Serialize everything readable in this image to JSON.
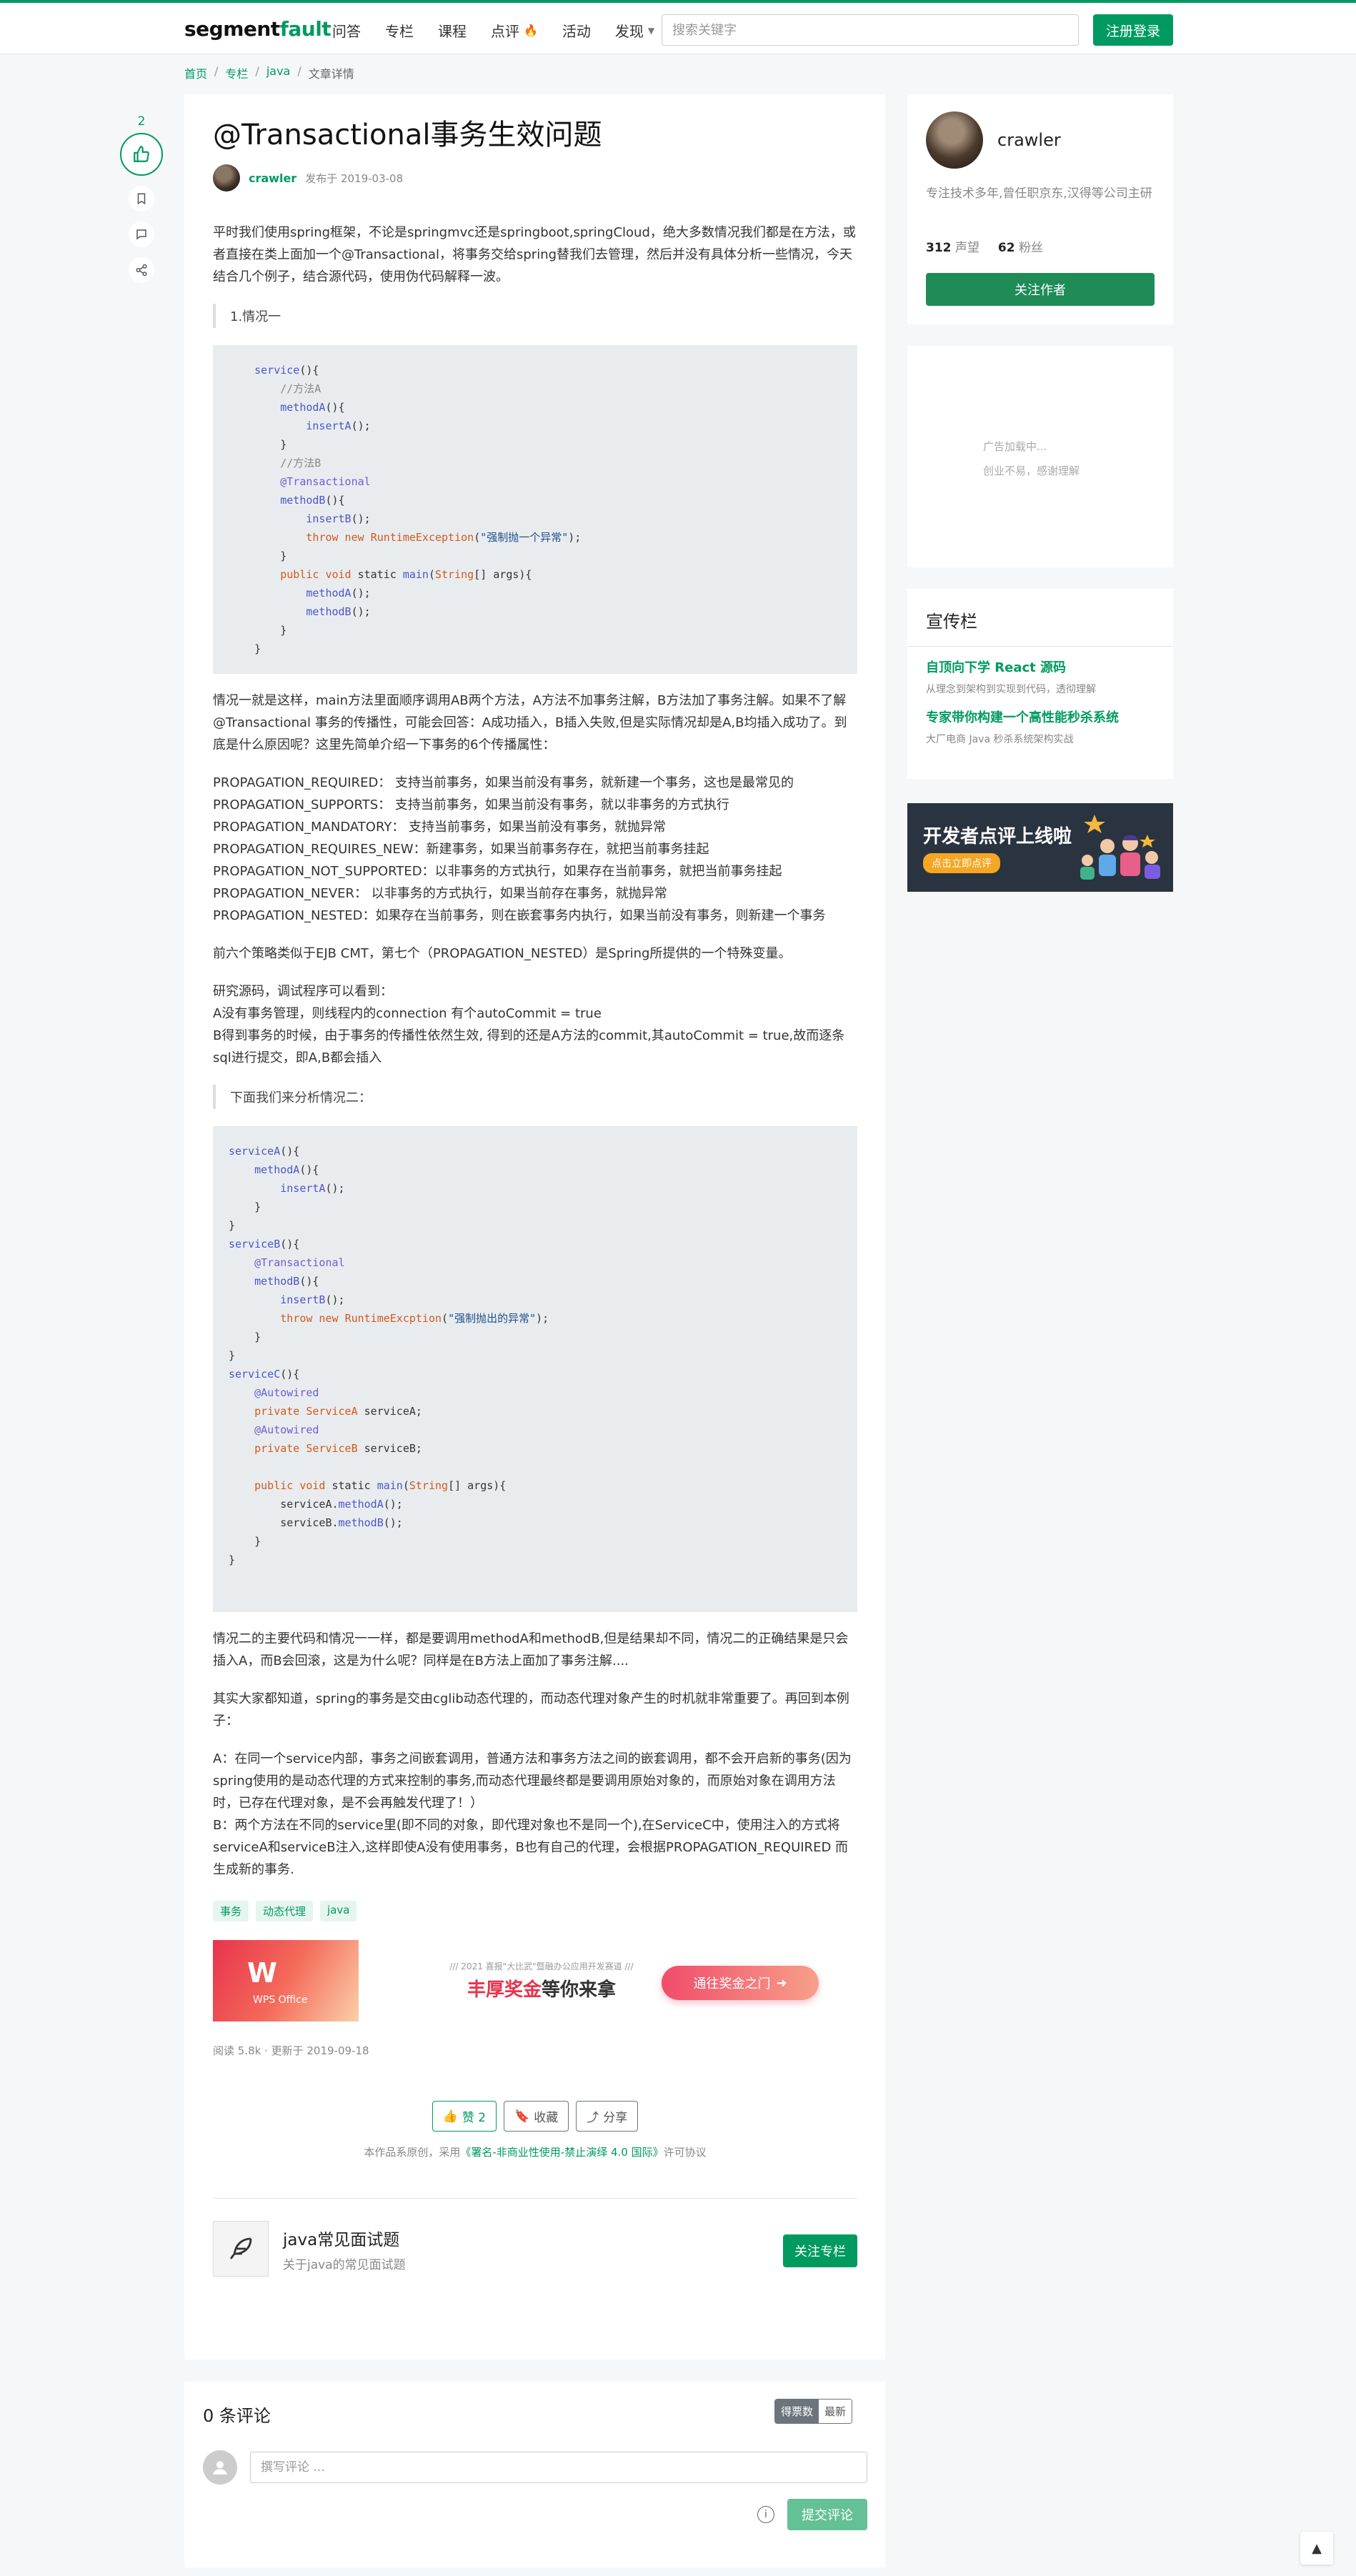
{
  "header": {
    "logo_text": "segment",
    "logo_bold": "fault",
    "nav": [
      "问答",
      "专栏",
      "课程",
      "点评",
      "活动",
      "发现"
    ],
    "search_placeholder": "搜索关键字",
    "register_label": "注册登录"
  },
  "breadcrumb": [
    "首页",
    "专栏",
    "java",
    "文章详情"
  ],
  "side": {
    "vote_count": "2"
  },
  "article": {
    "title": "@Transactional事务生效问题",
    "author": "crawler",
    "published": "发布于 2019-03-08",
    "intro": "平时我们使用spring框架，不论是springmvc还是springboot,springCloud，绝大多数情况我们都是在方法，或者直接在类上面加一个@Transactional，将事务交给spring替我们去管理，然后并没有具体分析一些情况，今天结合几个例子，结合源代码，使用伪代码解释一波。",
    "quote1": "1.情况一",
    "code1": [
      "    service(){",
      "        //方法A",
      "        methodA(){",
      "            insertA();",
      "        }",
      "        //方法B",
      "        @Transactional",
      "        methodB(){",
      "            insertB();",
      "            throw new RuntimeException(\"强制抛一个异常\");",
      "        }",
      "        public void static main(String[] args){",
      "            methodA();",
      "            methodB();",
      "        }",
      "    }"
    ],
    "para1": "情况一就是这样，main方法里面顺序调用AB两个方法，A方法不加事务注解，B方法加了事务注解。如果不了解@Transactional 事务的传播性，可能会回答：A成功插入，B插入失败,但是实际情况却是A,B均插入成功了。到底是什么原因呢？这里先简单介绍一下事务的6个传播属性：",
    "propagation": [
      "PROPAGATION_REQUIRED：  支持当前事务，如果当前没有事务，就新建一个事务，这也是最常见的",
      "PROPAGATION_SUPPORTS：  支持当前事务，如果当前没有事务，就以非事务的方式执行",
      "PROPAGATION_MANDATORY：  支持当前事务，如果当前没有事务，就抛异常",
      "PROPAGATION_REQUIRES_NEW：新建事务，如果当前事务存在，就把当前事务挂起",
      "PROPAGATION_NOT_SUPPORTED：以非事务的方式执行，如果存在当前事务，就把当前事务挂起",
      "PROPAGATION_NEVER：  以非事务的方式执行，如果当前存在事务，就抛异常",
      "PROPAGATION_NESTED：如果存在当前事务，则在嵌套事务内执行，如果当前没有事务，则新建一个事务"
    ],
    "para2": "前六个策略类似于EJB CMT，第七个（PROPAGATION_NESTED）是Spring所提供的一个特殊变量。",
    "para3": [
      "研究源码，调试程序可以看到：",
      "A没有事务管理，则线程内的connection 有个autoCommit = true",
      "B得到事务的时候，由于事务的传播性依然生效, 得到的还是A方法的commit,其autoCommit = true,故而逐条sql进行提交，即A,B都会插入"
    ],
    "quote2": "下面我们来分析情况二：",
    "code2": [
      "serviceA(){",
      "    methodA(){",
      "        insertA();",
      "    }",
      "}",
      "serviceB(){",
      "    @Transactional",
      "    methodB(){",
      "        insertB();",
      "        throw new RuntimeExcption(\"强制抛出的异常\");",
      "    }",
      "}",
      "serviceC(){",
      "    @Autowired",
      "    private ServiceA serviceA;",
      "    @Autowired",
      "    private ServiceB serviceB;",
      "",
      "    public void static main(String[] args){",
      "        serviceA.methodA();",
      "        serviceB.methodB();",
      "    }",
      "}"
    ],
    "para4": "情况二的主要代码和情况一一样，都是要调用methodA和methodB,但是结果却不同，情况二的正确结果是只会插入A，而B会回滚，这是为什么呢？同样是在B方法上面加了事务注解....",
    "para5": "其实大家都知道，spring的事务是交由cglib动态代理的，而动态代理对象产生的时机就非常重要了。再回到本例子：",
    "para6": [
      "A：在同一个service内部，事务之间嵌套调用，普通方法和事务方法之间的嵌套调用，都不会开启新的事务(因为spring使用的是动态代理的方式来控制的事务,而动态代理最终都是要调用原始对象的，而原始对象在调用方法时，已存在代理对象，是不会再触发代理了！）",
      "B：两个方法在不同的service里(即不同的对象，即代理对象也不是同一个),在ServiceC中，使用注入的方式将serviceA和serviceB注入,这样即使A没有使用事务，B也有自己的代理，会根据PROPAGATION_REQUIRED 而生成新的事务."
    ],
    "tags": [
      "事务",
      "动态代理",
      "java"
    ],
    "ad": {
      "brand": "WPS Office",
      "small": "/// 2021 喜报\"大比武\"暨融办公应用开发赛道 ///",
      "big_red": "丰厚奖金",
      "big_rest": "等你来拿",
      "button": "通往奖金之门"
    },
    "stats": "阅读 5.8k · 更新于 2019-09-18",
    "actions": {
      "like": "赞 2",
      "fav": "收藏",
      "share": "分享"
    },
    "license_prefix": "本作品系原创，采用",
    "license_link": "《署名-非商业性使用-禁止演绎 4.0 国际》",
    "license_suffix": "许可协议",
    "column": {
      "title": "java常见面试题",
      "desc": "关于java的常见面试题",
      "follow": "关注专栏"
    }
  },
  "comments": {
    "count_label": "0 条评论",
    "sort_hot": "得票数",
    "sort_new": "最新",
    "placeholder": "撰写评论 ...",
    "submit": "提交评论"
  },
  "sidebar": {
    "author": {
      "name": "crawler",
      "desc": "专注技术多年,曾任职京东,汉得等公司主研",
      "reputation": "312",
      "reputation_label": "声望",
      "fans": "62",
      "fans_label": "粉丝",
      "follow": "关注作者"
    },
    "ad_loading": "广告加载中...",
    "ad_note": "创业不易，感谢理解",
    "promo": {
      "title": "宣传栏",
      "items": [
        {
          "title": "自顶向下学 React 源码",
          "desc": "从理念到架构到实现到代码，透彻理解"
        },
        {
          "title": "专家带你构建一个高性能秒杀系统",
          "desc": "大厂电商 Java 秒杀系统架构实战"
        }
      ]
    },
    "banner": {
      "title": "开发者点评上线啦",
      "button": "点击立即点评"
    }
  },
  "back_top": "▲"
}
